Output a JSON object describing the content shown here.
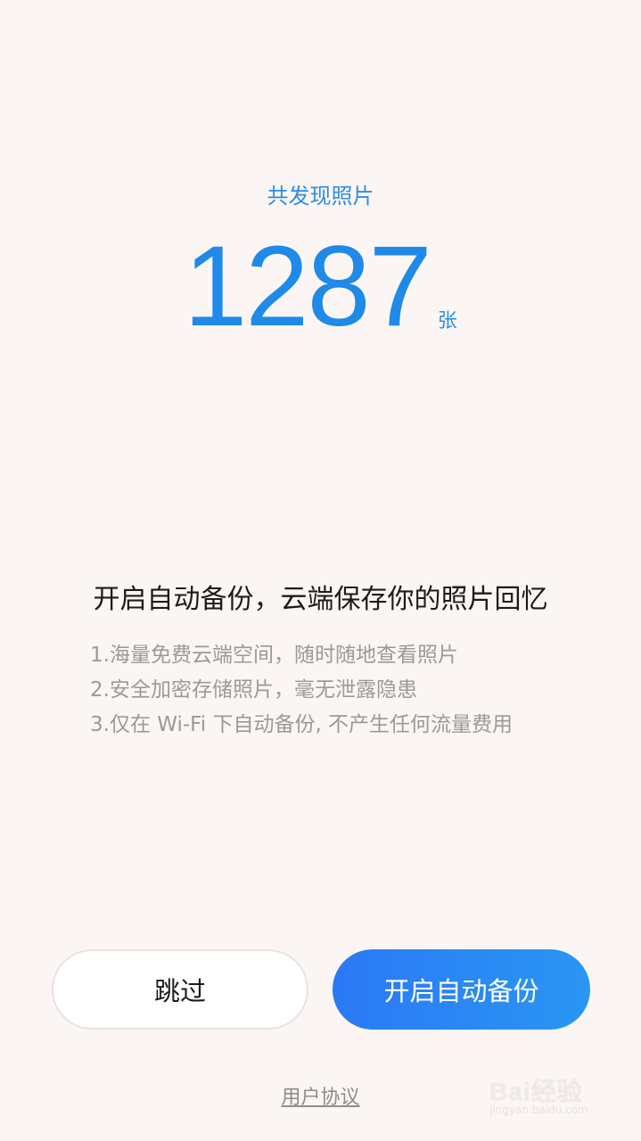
{
  "header": {
    "found_label": "共发现照片",
    "photo_count": "1287",
    "count_unit": "张"
  },
  "promo": {
    "headline": "开启自动备份，云端保存你的照片回忆",
    "features": [
      "1.海量免费云端空间，随时随地查看照片",
      "2.安全加密存储照片，毫无泄露隐患",
      "3.仅在 Wi-Fi 下自动备份, 不产生任何流量费用"
    ]
  },
  "actions": {
    "skip_label": "跳过",
    "enable_label": "开启自动备份"
  },
  "footer": {
    "agreement_label": "用户协议"
  },
  "watermark": {
    "logo_text": "Bai经验",
    "url_text": "jingyan.baidu.com"
  },
  "colors": {
    "background": "#fbf6f3",
    "accent": "#1f8ae8",
    "button_gradient_start": "#2a79f5",
    "button_gradient_end": "#2a96f3"
  }
}
